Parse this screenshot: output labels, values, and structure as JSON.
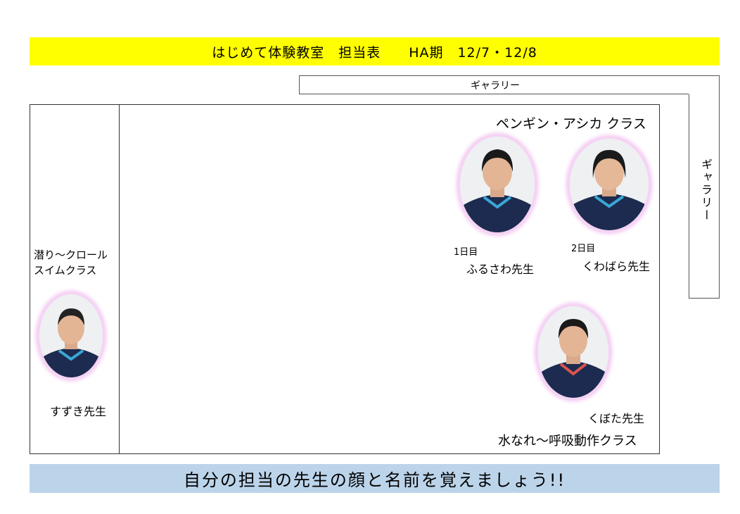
{
  "header": {
    "title": "はじめて体験教室　担当表　　HA期　12/7・12/8"
  },
  "gallery": {
    "top_label": "ギャラリー",
    "side_label": "ギャラリー"
  },
  "left_lane": {
    "class_line1": "潜り〜クロール",
    "class_line2": "スイムクラス",
    "teacher": "すずき先生"
  },
  "top_right": {
    "class_name": "ペンギン・アシカ クラス",
    "teacher1_day": "1日目",
    "teacher1_name": "ふるさわ先生",
    "teacher2_day": "2日目",
    "teacher2_name": "くわばら先生"
  },
  "bottom_right": {
    "teacher": "くぼた先生",
    "class_name": "水なれ〜呼吸動作クラス"
  },
  "footer": {
    "message": "自分の担当の先生の顔と名前を覚えましょう!!"
  },
  "colors": {
    "title_bg": "#ffff00",
    "footer_bg": "#bcd4ea",
    "photo_glow": "#f2c6f0",
    "jacket": "#1c2b4f",
    "jacket_stripe": "#3aa7d6"
  }
}
